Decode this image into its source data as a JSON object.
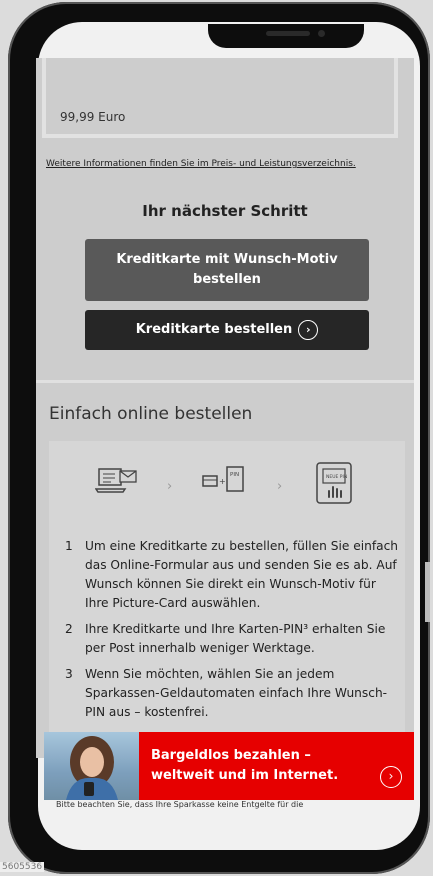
{
  "price": "99,99 Euro",
  "info_link": "Weitere Informationen finden Sie im Preis- und Leistungsverzeichnis.",
  "next_step": {
    "title": "Ihr nächster Schritt",
    "button_motiv": "Kreditkarte mit Wunsch-Motiv bestellen",
    "button_order": "Kreditkarte bestellen",
    "button_order_icon": "chevron-right-circle-icon"
  },
  "online": {
    "title": "Einfach online bestellen",
    "icons": [
      "laptop-mail-icon",
      "card-pin-letter-icon",
      "atm-icon"
    ],
    "pin_label": "PIN",
    "atm_label": "NEUE PIN",
    "steps": [
      {
        "num": "1",
        "text": "Um eine Kreditkarte zu bestellen, füllen Sie einfach das Online-Formular aus und senden Sie es ab. Auf Wunsch können Sie direkt ein Wunsch-Motiv für Ihre Picture-Card auswählen."
      },
      {
        "num": "2",
        "text": "Ihre Kreditkarte und Ihre Karten-PIN³ erhalten Sie per Post innerhalb weniger Werktage."
      },
      {
        "num": "3",
        "text": "Wenn Sie möchten, wählen Sie an jedem Sparkassen-Geldautomaten einfach Ihre Wunsch-PIN aus – kostenfrei."
      }
    ]
  },
  "banner": {
    "line1": "Bargeldlos bezahlen –",
    "line2": "weltweit und im Internet.",
    "icon": "chevron-right-circle-icon",
    "accent": "#e60000"
  },
  "footnote": "Bitte beachten Sie, dass Ihre Sparkasse keine Entgelte für die",
  "watermark": "5605536"
}
